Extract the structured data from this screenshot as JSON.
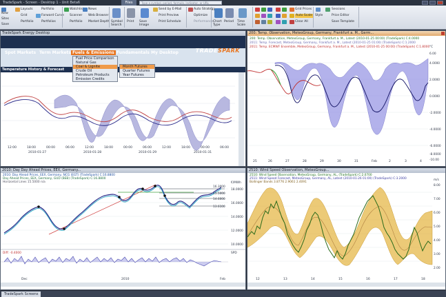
{
  "window": {
    "title": "TradeSpark - Screen - Desktop 1 - Unit Beta6",
    "file_tab": "Files",
    "search_placeholder": "Type a symbol, period, formula, indicator, or URL"
  },
  "ribbon": {
    "col1": [
      "New",
      "Sites",
      "Save"
    ],
    "col2": [
      "Layouts",
      "Grid",
      "Portfolio"
    ],
    "col3": [
      "Portfolio",
      "Forward Curve",
      "Portfolios"
    ],
    "col4": [
      "Watchlist",
      "Scanner",
      "Portfolio"
    ],
    "col5": [
      "News",
      "Web Browser",
      "Market Depth"
    ],
    "col6": [
      "Symbol Search"
    ],
    "col7": [
      "Print",
      "Save Image"
    ],
    "col8": [
      "Send by E-Mail",
      "Print Preview",
      "Print Schedule"
    ],
    "col9": [
      "Auto Strategy",
      "Optimize",
      "Performance"
    ],
    "col10": [
      "Chart Type",
      "Period",
      "Time Scale"
    ],
    "col11": [
      "Grid Prices",
      "Auto Scale",
      "Clear All"
    ],
    "col12": [
      "Style",
      "Sessions",
      "Price Editor",
      "Save Template"
    ]
  },
  "panels": {
    "desktop": {
      "title": "TradeSpark Energy Desktop",
      "nav": [
        "Spot Markets",
        "Term Markets",
        "Fuels & Emissions",
        "Fundamentals",
        "My Desktop"
      ],
      "logo_a": "TRADE",
      "logo_b": "SPARK",
      "menu": [
        "Fuel Price Comparison",
        "Natural Gas",
        "Coal & Lignite",
        "Crude Oil",
        "Petroleum Products",
        "Emission Credits"
      ],
      "submenu": [
        "Month Futures",
        "Quarter Futures",
        "Year Futures"
      ],
      "subheading": "Temperature History & Forecast",
      "xticks": [
        "12:00",
        "18:00",
        "00:00",
        "06:00",
        "12:00",
        "18:00",
        "00:00",
        "06:00",
        "12:00",
        "18:00",
        "00:00",
        "06:00"
      ],
      "dates": [
        "2010-01-27",
        "2010-01-28",
        "2010-01-29",
        "2010-01-31"
      ]
    },
    "temp": {
      "title": "200: Temp. Observation, MeteoGroup, Germany, Frankfurt a. M., Germ...",
      "legend": [
        "200: Temp. Observation, MeteoGroup, Germany, Frankfurt a. M., Latest (2010-01-25 00:00) (TradeSpark) C:4.0000",
        "2011: Temp. Forecast, MeteoGroup, Germany, Frankfurt a. M., Latest (2010-01-25 01:00) (TradeSpark) C:1.2000",
        "2011: Temp. ECMWF Ensemble, MeteoGroup, Germany, Frankfurt a. M., Latest (2010-01-25 00:00) (TradeSpark) C:1.8000"
      ],
      "yticks": [
        "6.00",
        "4.0000",
        "2.0000",
        "0.0000",
        "-2.0000",
        "-4.0000",
        "-6.0000",
        "-8.0000",
        "-10.00"
      ],
      "xticks": [
        "25",
        "26",
        "27",
        "28",
        "29",
        "30",
        "31",
        "Feb",
        "2",
        "3",
        "4"
      ],
      "unit": "°C"
    },
    "power": {
      "title": "2010: Day Day Ahead Prices, EEX, Germany...",
      "legend": [
        "2010: Day Ahead Prices, EEX, Germany, NCG (EGT) (TradeSpark) C:16.8800",
        "Day Ahead Prices, EEX, Germany, GUD (BEB) (TradeSpark) C:16.8800",
        "Horizontal Lines 15.5000 n/a"
      ],
      "unit": "€/MWh",
      "yticks": [
        "18.0000",
        "16.0000",
        "14.0000",
        "12.0000",
        "10.0000"
      ],
      "ylabels_right": [
        "16.3000",
        "15.5000",
        "14.6000",
        "13.6100"
      ],
      "diff_label": "Diff: -0.4000",
      "diff_unit": "SPD",
      "xticks": [
        "Dec",
        "2010",
        "Feb"
      ]
    },
    "wind": {
      "title": "2510: Wind Speed Observation, MeteoGroup...",
      "legend": [
        "2510: Wind Speed Observation, MeteoGroup, Germany, AL, (TradeSpark) C:2.0700",
        "2511: Wind Speed Forecast, MeteoGroup, Germany, AL, Latest (2010-01-26 01:00) (TradeSpark) C:3.2000",
        "Bollinger Bands 3.8776  2.9061  2.4091"
      ],
      "unit": "m/s",
      "yticks": [
        "8.00",
        "7.00",
        "6.00",
        "5.00",
        "4.00",
        "3.00",
        "2.00"
      ],
      "xticks": [
        "12",
        "13",
        "14",
        "15",
        "16",
        "17",
        "18"
      ]
    }
  },
  "status": {
    "tab": "TradeSpark Screens"
  },
  "chart_data": [
    {
      "type": "line",
      "name": "temperature_desktop",
      "series": [
        {
          "name": "Observation"
        },
        {
          "name": "Forecast"
        },
        {
          "name": "Ensemble band"
        }
      ]
    },
    {
      "type": "line",
      "name": "temperature",
      "x": [
        "25",
        "26",
        "27",
        "28",
        "29",
        "30",
        "31",
        "Feb",
        "2",
        "3",
        "4"
      ],
      "series": [
        {
          "name": "Temp. Observation",
          "values": [
            1,
            -3,
            -8,
            -6,
            -4,
            -6,
            -2,
            1,
            2,
            3,
            4
          ]
        },
        {
          "name": "Temp. Forecast",
          "values": [
            0,
            -2,
            -7,
            -5,
            -3,
            -5,
            -1,
            0,
            1,
            2,
            3
          ]
        }
      ],
      "ylim": [
        -10,
        6
      ]
    },
    {
      "type": "line",
      "name": "day_ahead_prices",
      "series": [
        {
          "name": "NCG",
          "values": [
            12.5,
            13.0,
            14.5,
            15.5,
            16.2,
            15.8,
            16.3,
            15.0,
            13.5,
            13.6,
            14.6,
            16.3
          ]
        },
        {
          "name": "GUD",
          "values": [
            12.3,
            12.9,
            14.2,
            15.3,
            16.0,
            15.5,
            16.1,
            14.8,
            13.4,
            13.5,
            14.5,
            16.0
          ]
        }
      ],
      "ylim": [
        10,
        18
      ]
    },
    {
      "type": "line",
      "name": "wind_speed",
      "x": [
        "12",
        "13",
        "14",
        "15",
        "16",
        "17",
        "18"
      ],
      "series": [
        {
          "name": "Wind Speed Observation",
          "values": [
            4.0,
            6.5,
            5.5,
            3.0,
            5.0,
            6.0,
            3.5,
            2.5
          ]
        },
        {
          "name": "Bollinger Bands",
          "values": [
            5,
            6.5,
            6,
            4,
            5.5,
            6.5,
            5,
            4
          ]
        }
      ],
      "ylim": [
        2,
        8
      ]
    }
  ]
}
